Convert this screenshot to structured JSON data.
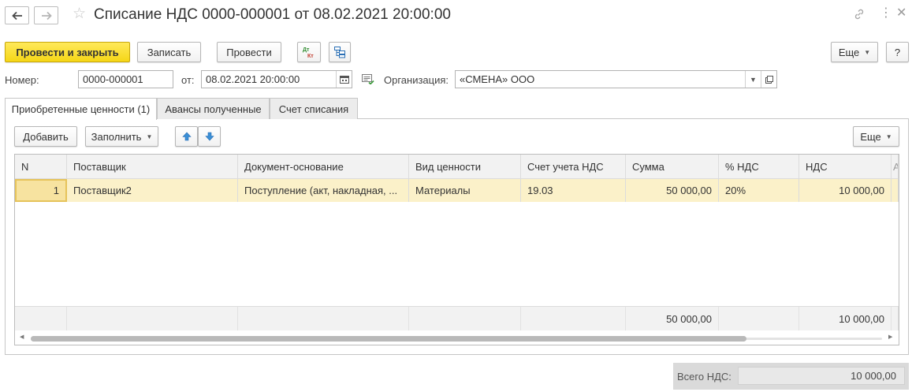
{
  "header": {
    "title": "Списание НДС 0000-000001 от 08.02.2021 20:00:00"
  },
  "toolbar": {
    "post_close": "Провести и закрыть",
    "save": "Записать",
    "post": "Провести",
    "more": "Еще",
    "help": "?"
  },
  "form": {
    "number_label": "Номер:",
    "number_value": "0000-000001",
    "date_label": "от:",
    "date_value": "08.02.2021 20:00:00",
    "org_label": "Организация:",
    "org_value": "«СМЕНА» ООО"
  },
  "tabs": [
    {
      "label": "Приобретенные ценности (1)",
      "active": true
    },
    {
      "label": "Авансы полученные",
      "active": false
    },
    {
      "label": "Счет списания",
      "active": false
    }
  ],
  "table_toolbar": {
    "add": "Добавить",
    "fill": "Заполнить",
    "more": "Еще"
  },
  "table": {
    "columns": [
      "N",
      "Поставщик",
      "Документ-основание",
      "Вид ценности",
      "Счет учета НДС",
      "Сумма",
      "% НДС",
      "НДС"
    ],
    "rows": [
      [
        "1",
        "Поставщик2",
        "Поступление (акт, накладная, ...",
        "Материалы",
        "19.03",
        "50 000,00",
        "20%",
        "10 000,00"
      ]
    ],
    "footer": [
      "",
      "",
      "",
      "",
      "",
      "50 000,00",
      "",
      "10 000,00"
    ]
  },
  "totals": {
    "label": "Всего НДС:",
    "value": "10 000,00"
  },
  "colors": {
    "primary_button": "#f5d616",
    "selected_row": "#fbf1c9",
    "header_bg": "#f2f2f2"
  }
}
